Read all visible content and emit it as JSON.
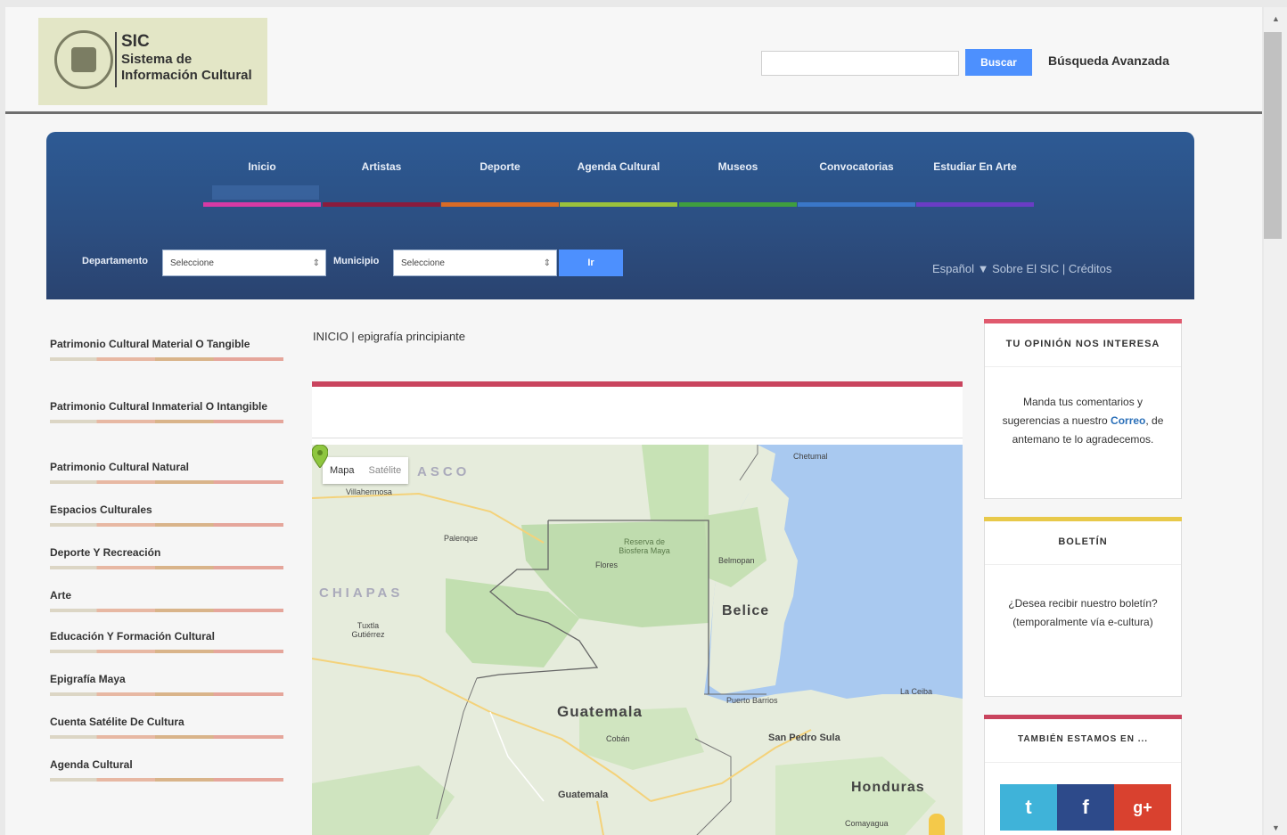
{
  "header": {
    "logo_line1": "SIC",
    "logo_line2": "Sistema de",
    "logo_line3": "Información Cultural",
    "search_value": "",
    "search_button": "Buscar",
    "advanced_search": "Búsqueda Avanzada"
  },
  "nav": {
    "items": [
      {
        "label": "Inicio",
        "color": "#d63aa5"
      },
      {
        "label": "Artistas",
        "color": "#8a1c3d"
      },
      {
        "label": "Deporte",
        "color": "#d86b26"
      },
      {
        "label": "Agenda Cultural",
        "color": "#9ac23c"
      },
      {
        "label": "Museos",
        "color": "#3f9e3f"
      },
      {
        "label": "Convocatorias",
        "color": "#3a77c8"
      },
      {
        "label": "Estudiar En Arte",
        "color": "#6a3dc5"
      }
    ]
  },
  "filters": {
    "department_label": "Departamento",
    "department_value": "Seleccione",
    "municipality_label": "Municipio",
    "municipality_value": "Seleccione",
    "go_button": "Ir",
    "language": "Español",
    "language_caret": "▼",
    "about": "Sobre El SIC",
    "separator": "|",
    "credits": "Créditos"
  },
  "sidebar": {
    "items": [
      "Patrimonio Cultural Material O Tangible",
      "Patrimonio Cultural Inmaterial O Intangible",
      "Patrimonio Cultural Natural",
      "Espacios Culturales",
      "Deporte Y Recreación",
      "Arte",
      "Educación Y Formación Cultural",
      "Epigrafía Maya",
      "Cuenta Satélite De Cultura",
      "Agenda Cultural"
    ]
  },
  "main": {
    "breadcrumb": "INICIO | epigrafía principiante"
  },
  "map": {
    "type_map": "Mapa",
    "type_satellite": "Satélite",
    "labels": {
      "belice": "Belice",
      "guatemala": "Guatemala",
      "chiapas": "CHIAPAS",
      "tabasco": "ASCO",
      "honduras": "Honduras",
      "san_pedro_sula": "San Pedro Sula",
      "guatemala_city": "Guatemala",
      "villahermosa": "Villahermosa",
      "belmopan": "Belmopan",
      "chetumal": "Chetumal",
      "palenque": "Palenque",
      "tuxtla": "Tuxtla Gutiérrez",
      "flores": "Flores",
      "cobán": "Cobán",
      "puerto_barrios": "Puerto Barrios",
      "la_ceiba": "La Ceiba",
      "reserva": "Reserva de Biosfera Maya",
      "comayagua": "Comayagua"
    }
  },
  "widgets": {
    "opinion_title": "TU OPINIÓN NOS INTERESA",
    "opinion_text_1": "Manda tus comentarios y sugerencias a nuestro",
    "opinion_mail": "Correo",
    "opinion_text_2": ", de antemano te lo agradecemos.",
    "bulletin_title": "BOLETÍN",
    "bulletin_text": "¿Desea recibir nuestro boletín? (temporalmente vía e-cultura)",
    "social_title": "TAMBIÉN ESTAMOS EN ...",
    "social_twitter": "t",
    "social_facebook": "f",
    "social_google": "g+"
  },
  "colors": {
    "nav_band": "#2c4f82",
    "button_blue": "#4d90fe",
    "opinion_accent": "#e05a6e",
    "bulletin_accent": "#e8c94a",
    "social_accent": "#c9445e",
    "twitter": "#3fb3d9",
    "facebook": "#2d4a8a",
    "google": "#d9412f"
  }
}
